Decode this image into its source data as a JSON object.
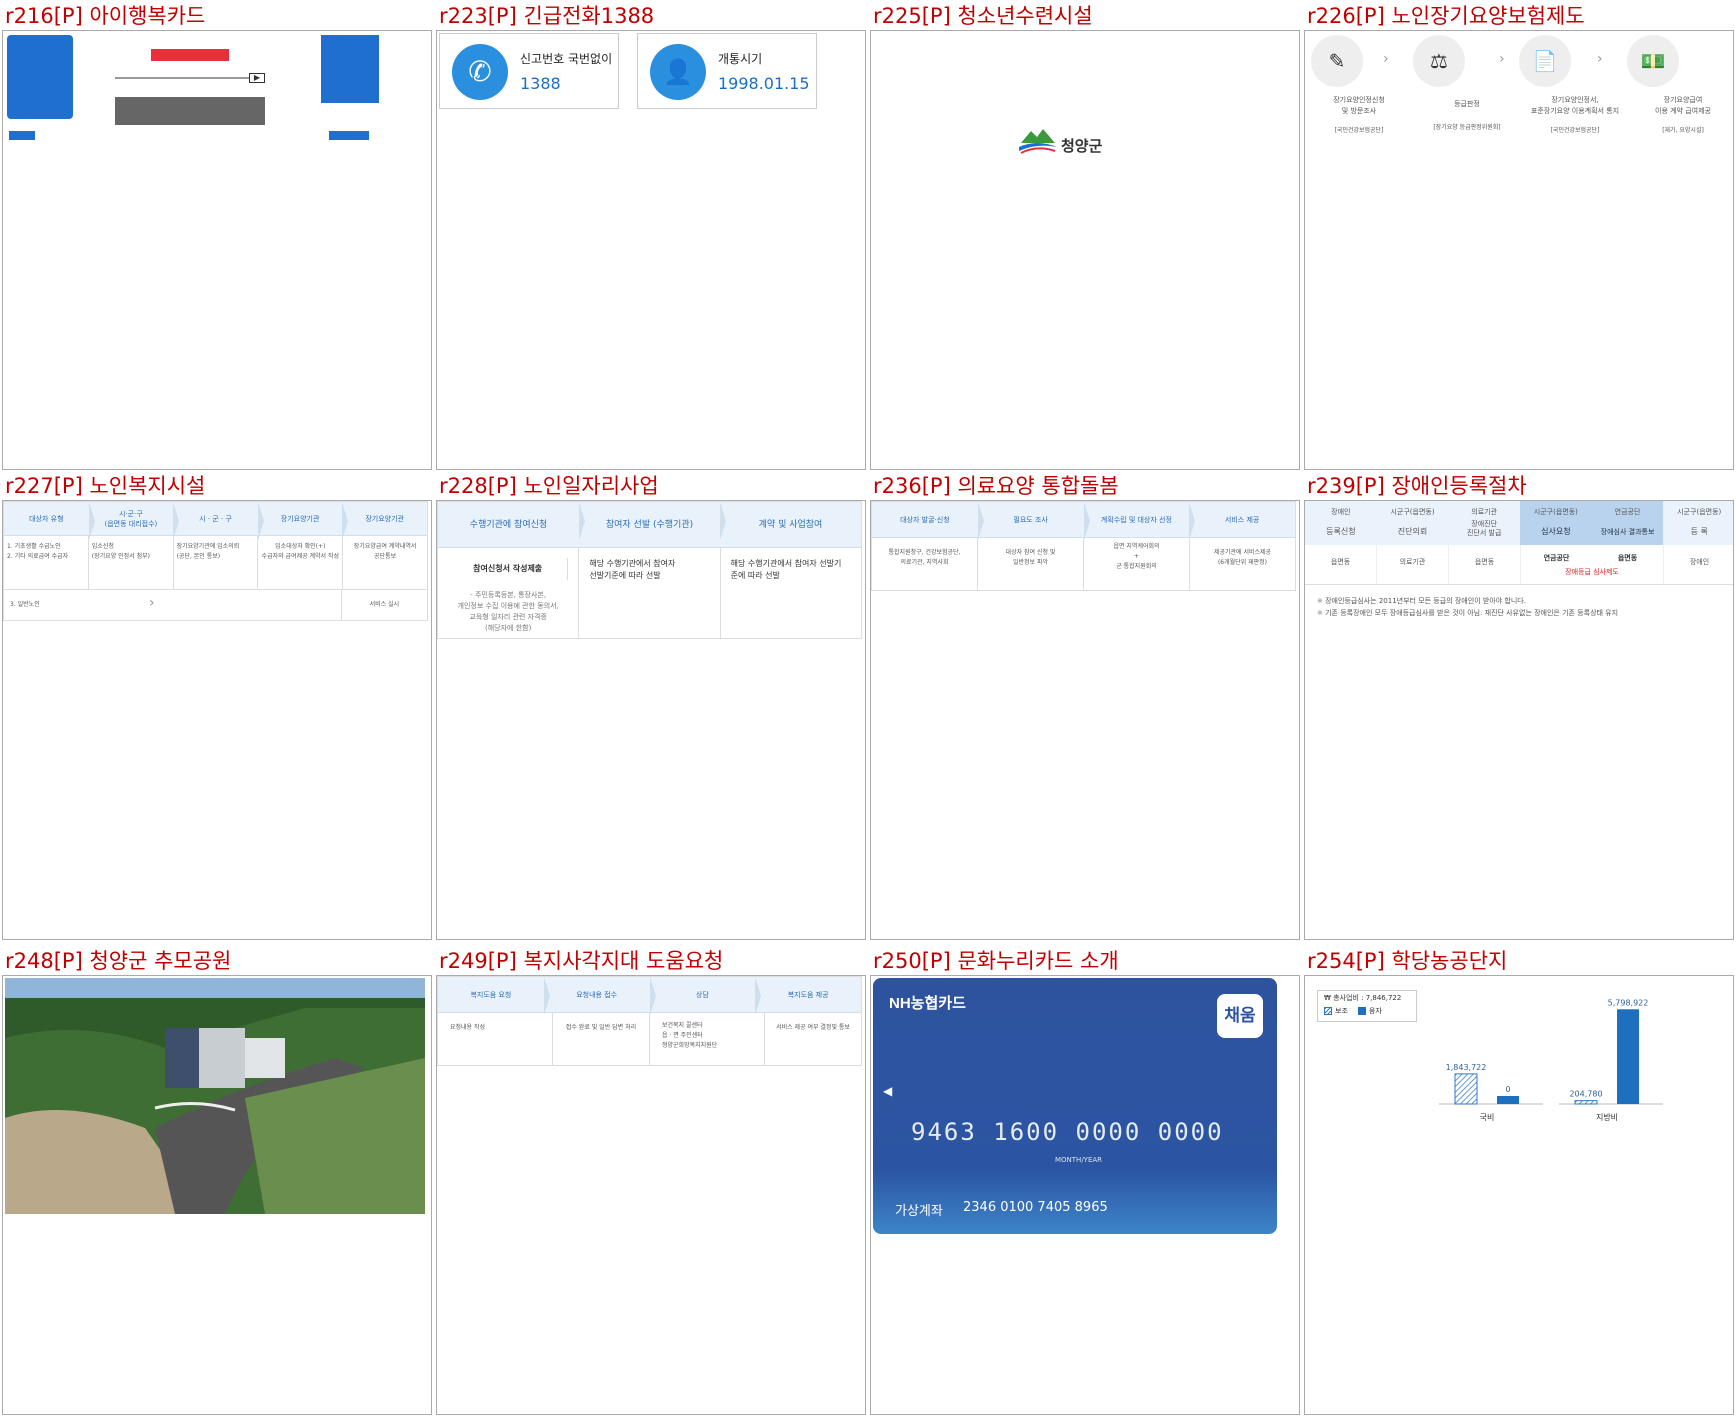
{
  "panels": [
    {
      "title": "r216[P] 아이행복카드"
    },
    {
      "title": "r223[P] 긴급전화1388"
    },
    {
      "title": "r225[P] 청소년수련시설"
    },
    {
      "title": "r226[P] 노인장기요양보험제도"
    },
    {
      "title": "r227[P] 노인복지시설"
    },
    {
      "title": "r228[P] 노인일자리사업"
    },
    {
      "title": "r236[P] 의료요양 통합돌봄"
    },
    {
      "title": "r239[P] 장애인등록절차"
    },
    {
      "title": "r248[P] 청양군 추모공원"
    },
    {
      "title": "r249[P] 복지사각지대 도움요청"
    },
    {
      "title": "r250[P] 문화누리카드 소개"
    },
    {
      "title": "r254[P] 학당농공단지"
    }
  ],
  "p223": {
    "card1_label": "신고번호 국번없이",
    "card1_value": "1388",
    "card2_label": "개통시기",
    "card2_value": "1998.01.15"
  },
  "p225": {
    "logo_text": "청양군"
  },
  "p226": {
    "steps": [
      {
        "label": "장기요양인정신청\n및 방문조사",
        "sub": "[국민건강보험공단]"
      },
      {
        "label": "등급판정",
        "sub": "[장기요양 등급판정위원회]"
      },
      {
        "label": "장기요양인정서,\n표준장기요양 이용계획서 통지",
        "sub": "[국민건강보험공단]"
      },
      {
        "label": "장기요양급여\n이용 계약 급여제공",
        "sub": "[재가, 요양시설]"
      }
    ]
  },
  "p227": {
    "heads": [
      "대상자 유형",
      "시·군·구\n(읍면동 대리접수)",
      "시 · 군 · 구",
      "장기요양기관",
      "장기요양기관"
    ],
    "row1": [
      "1. 기초생활 수급노인\n2. 기타 의료급여 수급자",
      "입소신청\n(장기요양 인정서 첨부)",
      "장기요양기관에 입소의뢰\n(공단, 본인 통보)",
      "입소대상자 확인(+)\n수급자와 급여제공 계약서 작성",
      "장기요양급여 계약내역서\n공단통보"
    ],
    "row2_left": "3. 일반노인",
    "row2_right": "서비스 실시"
  },
  "p228": {
    "heads": [
      "수행기관에 참여신청",
      "참여자 선발 (수행기관)",
      "계약 및 사업참여"
    ],
    "c1_title": "참여신청서 작성제출",
    "c1_body": "- 주민등록등본, 통장사본,\n  개인정보 수집 이용에 관한 동의서,\n  교육형 일자리 관련 자격증\n  (해당자에 한함)",
    "c2": "해당 수행기관에서 참여자\n선발기준에 따라 선발",
    "c3": "해당 수행기관에서 참여자 선발기\n준에 따라 선발"
  },
  "p236": {
    "heads": [
      "대상자 발굴·신청",
      "필요도 조사",
      "계획수립 및 대상자 선정",
      "서비스 제공"
    ],
    "body": [
      "통합지원창구, 건강보험공단,\n의료기관, 지역사회",
      "대상자 참여 신청 및\n일반정보 파악",
      "읍면 지역케어회의\n+\n군 통합지원회의",
      "제공기관에 서비스제공\n(6개월단위 재판정)"
    ]
  },
  "p239": {
    "tops": [
      "장애인",
      "시군구(읍면동)",
      "의료기관",
      "시군구(읍면동)",
      "연금공단",
      "시군구(읍면동)"
    ],
    "mains": [
      "등록신청",
      "진단의뢰",
      "장애진단\n진단서 발급",
      "심사요청",
      "장애심사 결과통보",
      "등 록"
    ],
    "row": [
      "읍면동",
      "의료기관",
      "읍면동",
      "연금공단",
      "읍면동",
      "장애인"
    ],
    "red_note": "장애등급 심사제도",
    "notes": [
      "장애인등급심사는 2011년부터 모든 등급의 장애인이 받아야 합니다.",
      "기존 등록장애인 모두 장애등급심사를 받은 것이 아님. 재진단 사유없는 장애인은 기존 등록상태 유지"
    ]
  },
  "p249": {
    "heads": [
      "복지도움 요청",
      "요청내용 접수",
      "상담",
      "복지도움 제공"
    ],
    "body": [
      "요청내용 작성",
      "접수 완료 및 일반 답변 처리",
      "보건복지 콜센터\n읍 · 면 주민센터\n청양군희망복지지원단",
      "서비스 제공 여부 결정및 통보"
    ]
  },
  "p250": {
    "brand": "NH농협카드",
    "badge": "채움",
    "number": "9463 1600 0000 0000",
    "month_year": "MONTH/YEAR",
    "virtual_label": "가상계좌",
    "virtual_num": "2346 0100 7405 8965"
  },
  "p254": {
    "legend_total": "₩ 총사업비 : 7,846,722",
    "legend_a": "보조",
    "legend_b": "융자"
  },
  "chart_data": {
    "type": "bar",
    "categories": [
      "국비",
      "지방비"
    ],
    "series": [
      {
        "name": "보조",
        "values": [
          1843722,
          204780
        ]
      },
      {
        "name": "융자",
        "values": [
          0,
          5798922
        ]
      }
    ],
    "labels": [
      "1,843,722",
      "0",
      "204,780",
      "5,798,922"
    ],
    "title": "",
    "xlabel": "",
    "ylabel": "",
    "ylim": [
      0,
      6000000
    ],
    "grid": false,
    "legend": "top-left",
    "colors": {
      "보조": "#2f78c4",
      "융자": "#1f6fbf"
    }
  }
}
